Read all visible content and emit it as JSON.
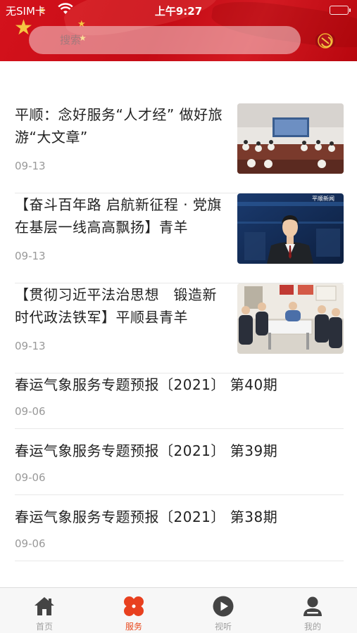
{
  "status_bar": {
    "carrier": "无SIM卡",
    "time": "上午9:27"
  },
  "search": {
    "placeholder": "搜索"
  },
  "news": [
    {
      "title": "平顺：念好服务“人才经” 做好旅游“大文章”",
      "date": "09-13",
      "thumbnail": "meeting-hall-photo"
    },
    {
      "title": "【奋斗百年路 启航新征程 · 党旗在基层一线高高飘扬】青羊",
      "date": "09-13",
      "thumbnail": "news-anchor-photo",
      "thumb_caption": "平顺新闻"
    },
    {
      "title": "【贯彻习近平法治思想　锻造新时代政法铁军】平顺县青羊",
      "date": "09-13",
      "thumbnail": "community-visit-photo"
    },
    {
      "title": "春运气象服务专题预报〔2021〕 第40期",
      "date": "09-06"
    },
    {
      "title": "春运气象服务专题预报〔2021〕 第39期",
      "date": "09-06"
    },
    {
      "title": "春运气象服务专题预报〔2021〕 第38期",
      "date": "09-06"
    }
  ],
  "tabs": [
    {
      "label": "首页",
      "icon": "home-icon",
      "active": false
    },
    {
      "label": "服务",
      "icon": "clover-icon",
      "active": true
    },
    {
      "label": "视听",
      "icon": "play-icon",
      "active": false
    },
    {
      "label": "我的",
      "icon": "user-icon",
      "active": false
    }
  ],
  "colors": {
    "header_red": "#c50b15",
    "star_gold": "#f5c542",
    "active_tab": "#e84a1f",
    "inactive_tab": "#a0a0a0",
    "date_gray": "#999999"
  }
}
